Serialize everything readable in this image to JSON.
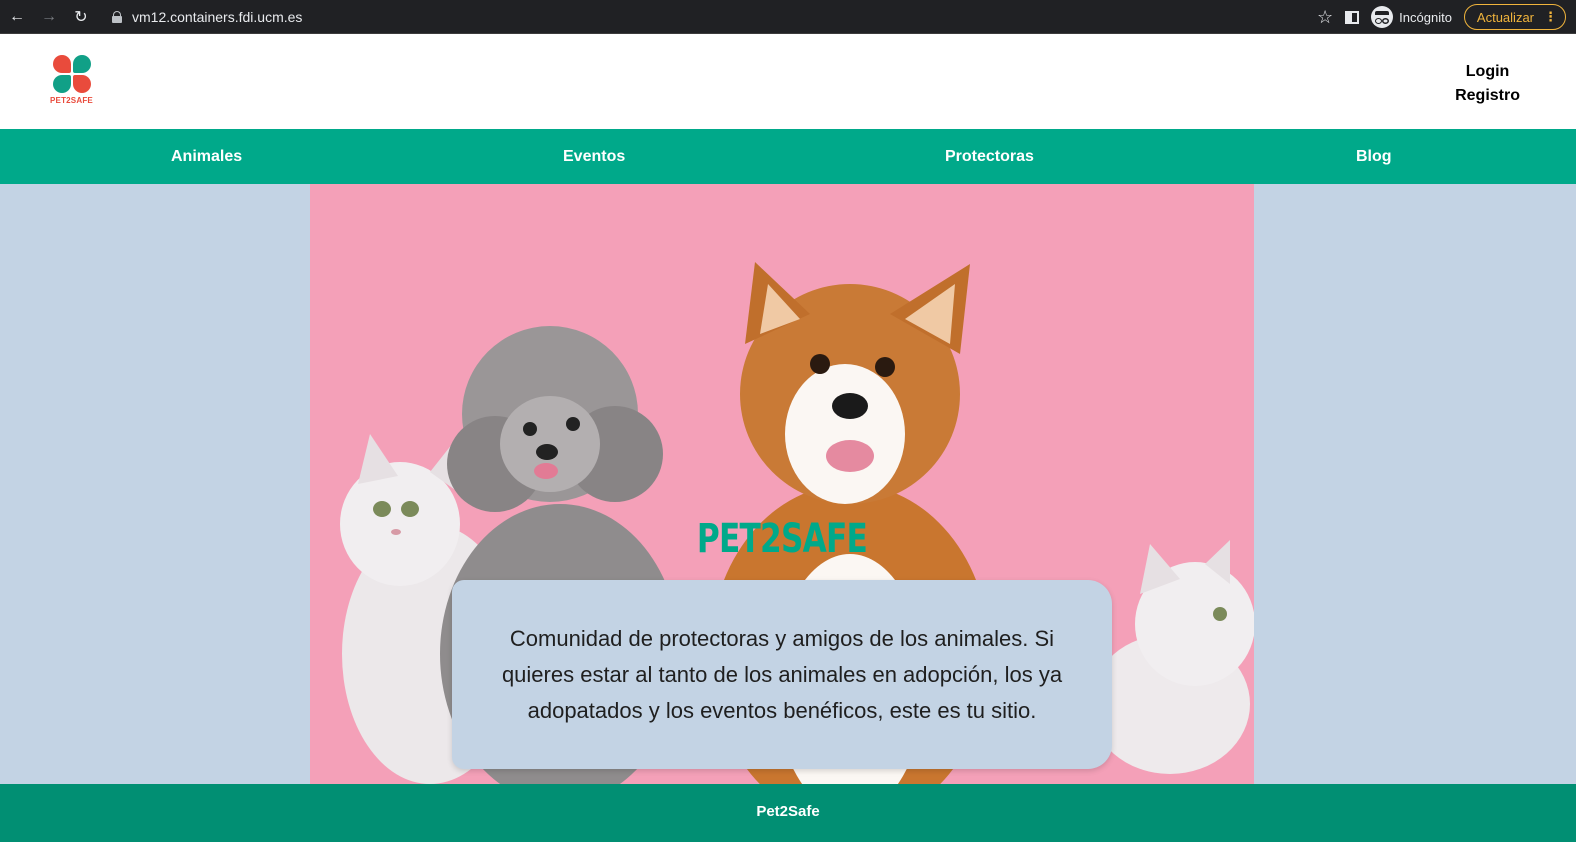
{
  "browser": {
    "url": "vm12.containers.fdi.ucm.es",
    "incognito_label": "Incógnito",
    "update_label": "Actualizar"
  },
  "header": {
    "logo_text": "PET2SAFE",
    "login_label": "Login",
    "register_label": "Registro"
  },
  "nav": {
    "items": [
      {
        "label": "Animales"
      },
      {
        "label": "Eventos"
      },
      {
        "label": "Protectoras"
      },
      {
        "label": "Blog"
      }
    ]
  },
  "hero": {
    "title": "PET2SAFE",
    "description": "Comunidad de protectoras y amigos de los animales. Si quieres estar al tanto de los animales en adopción, los ya adopatados y los eventos benéficos, este es tu sitio."
  },
  "footer": {
    "text": "Pet2Safe"
  },
  "colors": {
    "brand_green": "#00a98a",
    "footer_green": "#018f73",
    "page_background": "#c3d3e4",
    "hero_pink": "#f4a0b8",
    "logo_red": "#e94b3c"
  }
}
